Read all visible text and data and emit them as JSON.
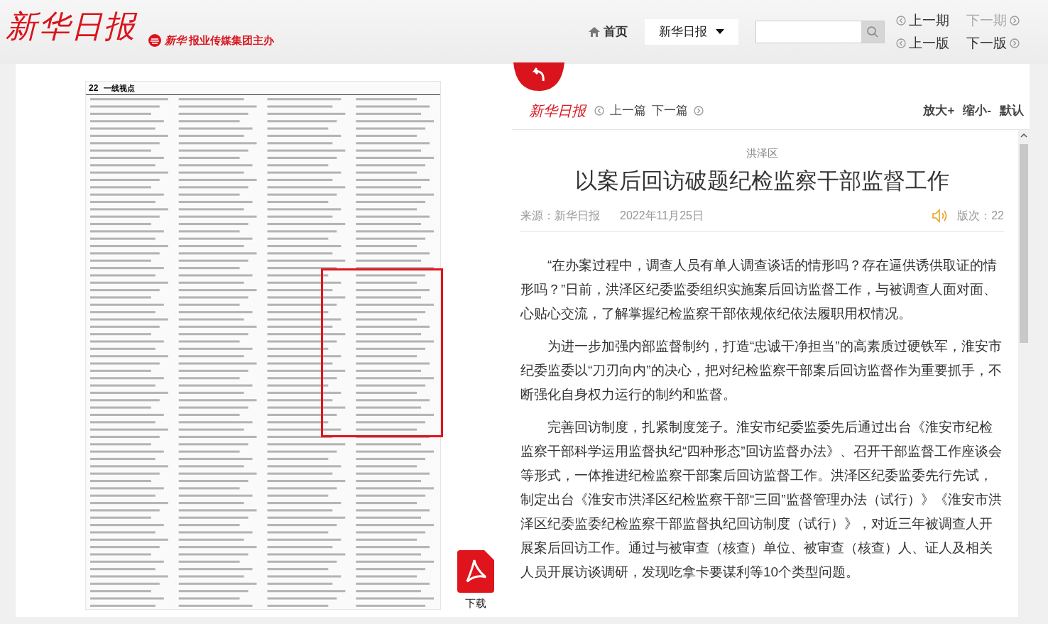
{
  "header": {
    "logo": "新华日报",
    "sponsor_mark": "新华",
    "sponsor": "报业传媒集团主办",
    "nav": {
      "home": "首页",
      "edition_select": "新华日报",
      "prev_issue": "上一期",
      "next_issue": "下一期",
      "prev_page": "上一版",
      "next_page": "下一版",
      "next_issue_disabled": true
    }
  },
  "newspaper": {
    "page_number": "22",
    "section": "一线视点",
    "highlight": true,
    "download": "下载"
  },
  "article_panel": {
    "logo": "新华日报",
    "prev": "上一篇",
    "next": "下一篇",
    "zoom_in": "放大+",
    "zoom_out": "缩小-",
    "reset": "默认",
    "kicker": "洪泽区",
    "title": "以案后回访破题纪检监察干部监督工作",
    "source": "来源：新华日报",
    "date": "2022年11月25日",
    "page_label": "版次：22",
    "paragraphs": [
      "“在办案过程中，调查人员有单人调查谈话的情形吗？存在逼供诱供取证的情形吗？”日前，洪泽区纪委监委组织实施案后回访监督工作，与被调查人面对面、心贴心交流，了解掌握纪检监察干部依规依纪依法履职用权情况。",
      "为进一步加强内部监督制约，打造“忠诚干净担当”的高素质过硬铁军，淮安市纪委监委以“刀刃向内”的决心，把对纪检监察干部案后回访监督作为重要抓手，不断强化自身权力运行的制约和监督。",
      "完善回访制度，扎紧制度笼子。淮安市纪委监委先后通过出台《淮安市纪检监察干部科学运用监督执纪“四种形态”回访监督办法》、召开干部监督工作座谈会等形式，一体推进纪检监察干部案后回访监督工作。洪泽区纪委监委先行先试，制定出台《淮安市洪泽区纪检监察干部“三回”监督管理办法（试行）》《淮安市洪泽区纪委监委纪检监察干部监督执纪回访制度（试行）》，对近三年被调查人开展案后回访工作。通过与被审查（核查）单位、被审查（核查）人、证人及相关人员开展访谈调研，发现吃拿卡要谋利等10个类型问题。"
    ]
  }
}
